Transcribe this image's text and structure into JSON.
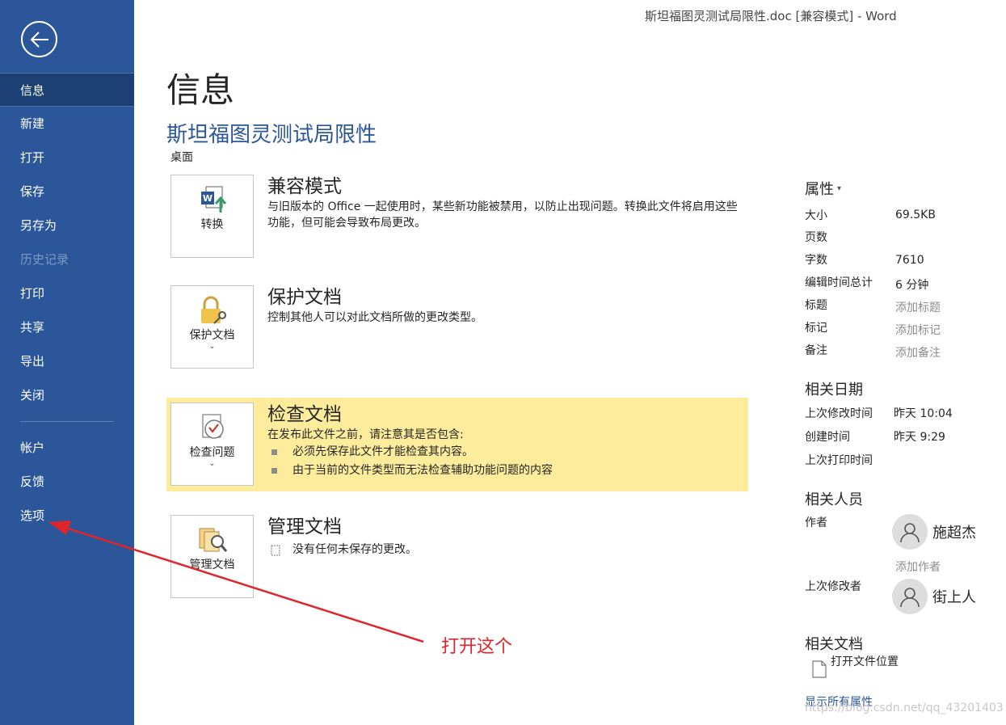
{
  "window": {
    "title": "斯坦福图灵测试局限性.doc [兼容模式]  -  Word"
  },
  "sidebar": {
    "items": [
      {
        "label": "信息"
      },
      {
        "label": "新建"
      },
      {
        "label": "打开"
      },
      {
        "label": "保存"
      },
      {
        "label": "另存为"
      },
      {
        "label": "历史记录"
      },
      {
        "label": "打印"
      },
      {
        "label": "共享"
      },
      {
        "label": "导出"
      },
      {
        "label": "关闭"
      }
    ],
    "bottom_items": [
      {
        "label": "帐户"
      },
      {
        "label": "反馈"
      },
      {
        "label": "选项"
      }
    ],
    "active_index": 0,
    "accent": "#2b579a"
  },
  "main": {
    "page_title": "信息",
    "doc_title": "斯坦福图灵测试局限性",
    "doc_location": "桌面",
    "sections": [
      {
        "tile_label": "转换",
        "icon": "word-convert-icon",
        "heading": "兼容模式",
        "description": "与旧版本的 Office 一起使用时，某些新功能被禁用，以防止出现问题。转换此文件将启用这些功能，但可能会导致布局更改。"
      },
      {
        "tile_label": "保护文档",
        "icon": "lock-key-icon",
        "heading": "保护文档",
        "description": "控制其他人可以对此文档所做的更改类型。"
      },
      {
        "tile_label": "检查问题",
        "icon": "inspect-document-icon",
        "heading": "检查文档",
        "description": "在发布此文件之前，请注意其是否包含:",
        "bullets": [
          "必须先保存此文件才能检查其内容。",
          "由于当前的文件类型而无法检查辅助功能问题的内容"
        ],
        "highlight_color": "#fcec9b"
      },
      {
        "tile_label": "管理文档",
        "icon": "manage-document-icon",
        "heading": "管理文档",
        "description": "没有任何未保存的更改。"
      }
    ]
  },
  "properties": {
    "heading": "属性",
    "rows": [
      {
        "label": "大小",
        "value": "69.5KB"
      },
      {
        "label": "页数",
        "value": ""
      },
      {
        "label": "字数",
        "value": "7610"
      },
      {
        "label": "编辑时间总计",
        "value": "6 分钟"
      },
      {
        "label": "标题",
        "value": "添加标题"
      },
      {
        "label": "标记",
        "value": "添加标记"
      },
      {
        "label": "备注",
        "value": "添加备注"
      }
    ],
    "dates_heading": "相关日期",
    "dates": [
      {
        "label": "上次修改时间",
        "value": "昨天 10:04"
      },
      {
        "label": "创建时间",
        "value": "昨天 9:29"
      },
      {
        "label": "上次打印时间",
        "value": ""
      }
    ],
    "people_heading": "相关人员",
    "author_label": "作者",
    "author_name": "施超杰",
    "add_author": "添加作者",
    "last_modified_by_label": "上次修改者",
    "last_modified_by_name": "街上人",
    "docs_heading": "相关文档",
    "open_location": "打开文件位置",
    "show_all": "显示所有属性"
  },
  "annotation": {
    "text": "打开这个",
    "color": "#e0252b"
  },
  "watermark": "https://blog.csdn.net/qq_43201403"
}
